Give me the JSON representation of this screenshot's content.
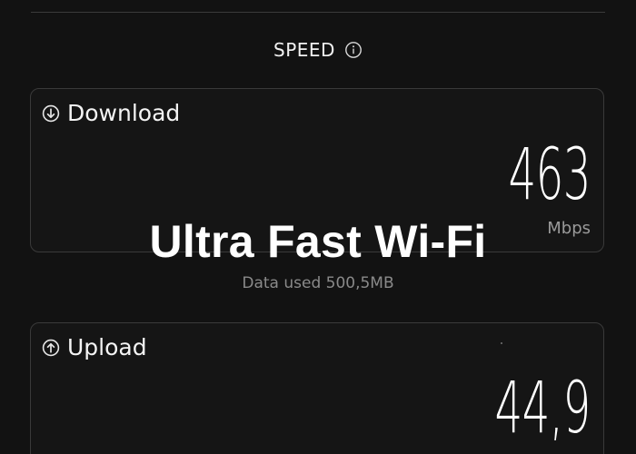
{
  "section": {
    "title": "SPEED",
    "info_icon": "info-icon"
  },
  "download": {
    "label": "Download",
    "icon": "download-arrow-icon",
    "value": "463",
    "unit": "Mbps"
  },
  "overlay": {
    "caption": "Ultra Fast Wi-Fi"
  },
  "data_used": "Data used 500,5MB",
  "upload": {
    "label": "Upload",
    "icon": "upload-arrow-icon",
    "value": "44,9"
  },
  "colors": {
    "background": "#121212",
    "card_border": "#3a3a3a",
    "secondary_text": "#8a8a8a",
    "unit_text": "#9a9a9a"
  }
}
